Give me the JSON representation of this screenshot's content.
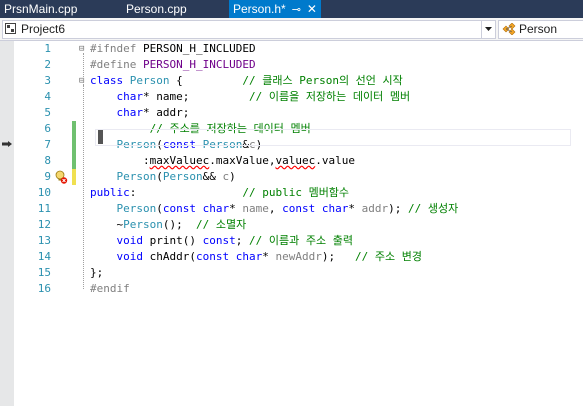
{
  "tabs": [
    {
      "label": "PrsnMain.cpp",
      "active": false
    },
    {
      "label": "Person.cpp",
      "active": false
    },
    {
      "label": "Person.h*",
      "active": true,
      "pin": "⊸",
      "close": "✕"
    }
  ],
  "navbar": {
    "project": "Project6",
    "scope": "Person"
  },
  "colors": {
    "tab_bar": "#2b3b58",
    "active_tab": "#007acc",
    "line_number": "#2b91af",
    "keyword": "#0000ff",
    "type": "#2b91af",
    "comment": "#008000",
    "change_saved": "#6fc06f",
    "change_unsaved": "#f0e050"
  },
  "editor": {
    "lines": [
      {
        "n": "1",
        "t": "#ifndef PERSON_H_INCLUDED"
      },
      {
        "n": "2",
        "t": "#define PERSON_H_INCLUDED"
      },
      {
        "n": "3",
        "t": "class Person {         // 클래스 Person의 선언 시작"
      },
      {
        "n": "4",
        "t": "    char* name;         // 이름을 저장하는 데이터 멤버"
      },
      {
        "n": "5",
        "t": "    char* addr;"
      },
      {
        "n": "6",
        "t": "         // 주소를 저장하는 데이터 멤버"
      },
      {
        "n": "7",
        "t": "    Person(const Person&c)"
      },
      {
        "n": "8",
        "t": "        :maxValuec.maxValue,valuec.value"
      },
      {
        "n": "9",
        "t": "    Person(Person&& c)"
      },
      {
        "n": "10",
        "t": "public:                // public 멤버함수"
      },
      {
        "n": "11",
        "t": "    Person(const char* name, const char* addr); // 생성자"
      },
      {
        "n": "12",
        "t": "    ~Person();  // 소멸자"
      },
      {
        "n": "13",
        "t": "    void print() const; // 이름과 주소 출력"
      },
      {
        "n": "14",
        "t": "    void chAddr(const char* newAddr);   // 주소 변경"
      },
      {
        "n": "15",
        "t": "};"
      },
      {
        "n": "16",
        "t": "#endif"
      }
    ]
  }
}
